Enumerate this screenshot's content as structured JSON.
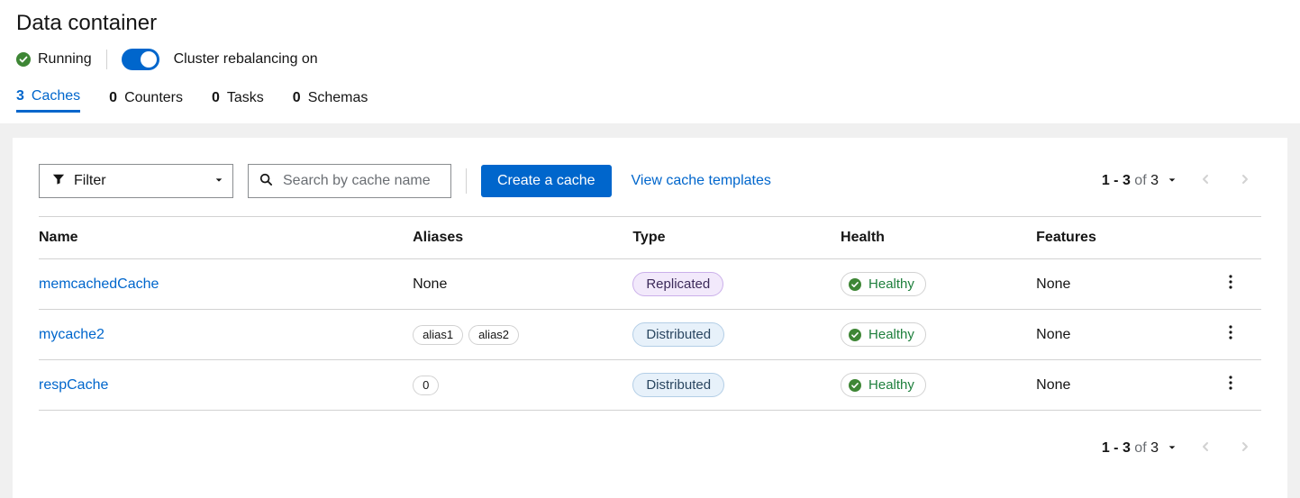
{
  "page": {
    "title": "Data container"
  },
  "status": {
    "label": "Running",
    "toggle_label": "Cluster rebalancing on"
  },
  "tabs": {
    "caches": {
      "count": "3",
      "label": "Caches"
    },
    "counters": {
      "count": "0",
      "label": "Counters"
    },
    "tasks": {
      "count": "0",
      "label": "Tasks"
    },
    "schemas": {
      "count": "0",
      "label": "Schemas"
    }
  },
  "toolbar": {
    "filter_label": "Filter",
    "search_placeholder": "Search by cache name",
    "create_label": "Create a cache",
    "templates_label": "View cache templates"
  },
  "pager": {
    "range": "1 - 3",
    "of": "of",
    "total": "3"
  },
  "columns": {
    "name": "Name",
    "aliases": "Aliases",
    "type": "Type",
    "health": "Health",
    "features": "Features"
  },
  "rows": [
    {
      "name": "memcachedCache",
      "aliases_text": "None",
      "aliases": [],
      "type": "Replicated",
      "health": "Healthy",
      "features": "None"
    },
    {
      "name": "mycache2",
      "aliases_text": "",
      "aliases": [
        "alias1",
        "alias2"
      ],
      "type": "Distributed",
      "health": "Healthy",
      "features": "None"
    },
    {
      "name": "respCache",
      "aliases_text": "",
      "aliases": [
        "0"
      ],
      "type": "Distributed",
      "health": "Healthy",
      "features": "None"
    }
  ]
}
